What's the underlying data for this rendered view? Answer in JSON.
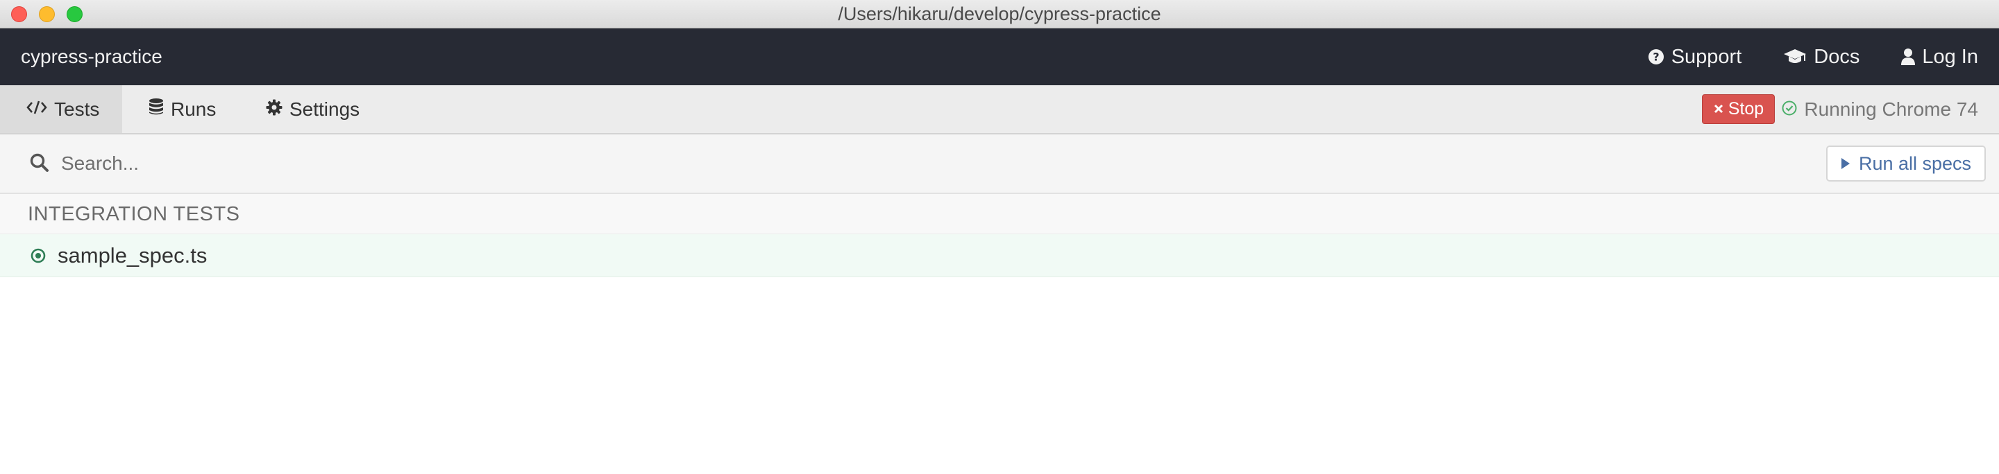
{
  "window": {
    "title": "/Users/hikaru/develop/cypress-practice"
  },
  "header": {
    "project_name": "cypress-practice",
    "links": [
      {
        "label": "Support",
        "icon": "question-circle-icon"
      },
      {
        "label": "Docs",
        "icon": "graduation-cap-icon"
      },
      {
        "label": "Log In",
        "icon": "user-icon"
      }
    ]
  },
  "tabs": [
    {
      "label": "Tests",
      "icon": "code-icon",
      "active": true
    },
    {
      "label": "Runs",
      "icon": "database-icon",
      "active": false
    },
    {
      "label": "Settings",
      "icon": "gear-icon",
      "active": false
    }
  ],
  "run_controls": {
    "stop_label": "Stop",
    "stop_icon": "times-icon",
    "status": "Running Chrome 74",
    "status_icon": "check-circle-icon"
  },
  "search": {
    "placeholder": "Search...",
    "value": "",
    "icon": "search-icon"
  },
  "run_all": {
    "label": "Run all specs",
    "icon": "play-icon"
  },
  "specs": {
    "section_title": "INTEGRATION TESTS",
    "items": [
      {
        "name": "sample_spec.ts",
        "icon": "dot-circle-icon"
      }
    ]
  },
  "colors": {
    "header_bg": "#272a34",
    "stop_red": "#d9534f",
    "running_green": "#4caf6a",
    "run_all_blue": "#4a6fa5",
    "spec_icon_green": "#2e7d55",
    "spec_row_bg": "#f1faf5"
  }
}
